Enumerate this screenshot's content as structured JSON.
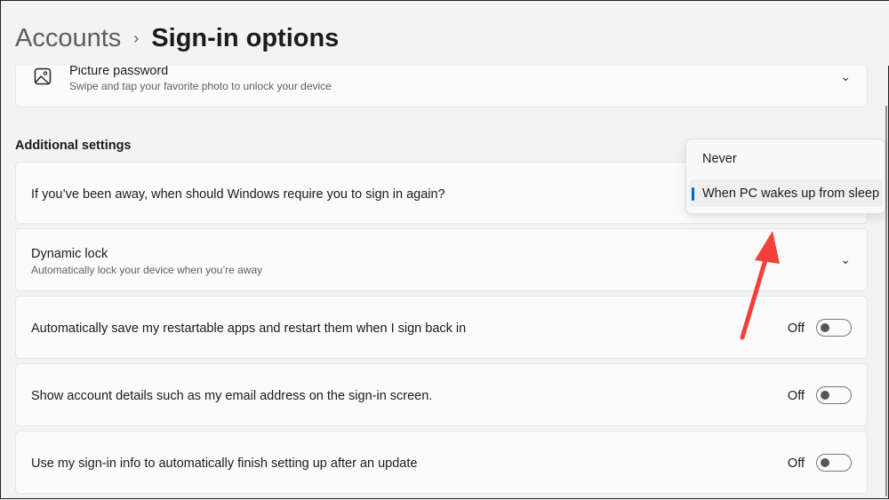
{
  "header": {
    "breadcrumb_parent": "Accounts",
    "separator": "›",
    "title": "Sign-in options"
  },
  "picture_password": {
    "label": "Picture password",
    "description": "Swipe and tap your favorite photo to unlock your device"
  },
  "additional_settings": {
    "heading": "Additional settings",
    "require_signin": {
      "label": "If you’ve been away, when should Windows require you to sign in again?"
    },
    "dropdown": {
      "options": [
        "Never",
        "When PC wakes up from sleep"
      ],
      "selected": "When PC wakes up from sleep"
    },
    "dynamic_lock": {
      "label": "Dynamic lock",
      "description": "Automatically lock your device when you’re away"
    },
    "toggles": [
      {
        "label": "Automatically save my restartable apps and restart them when I sign back in",
        "state": "Off"
      },
      {
        "label": "Show account details such as my email address on the sign-in screen.",
        "state": "Off"
      },
      {
        "label": "Use my sign-in info to automatically finish setting up after an update",
        "state": "Off"
      }
    ]
  },
  "colors": {
    "accent": "#0067c0",
    "annotation_arrow": "#f2403a"
  }
}
